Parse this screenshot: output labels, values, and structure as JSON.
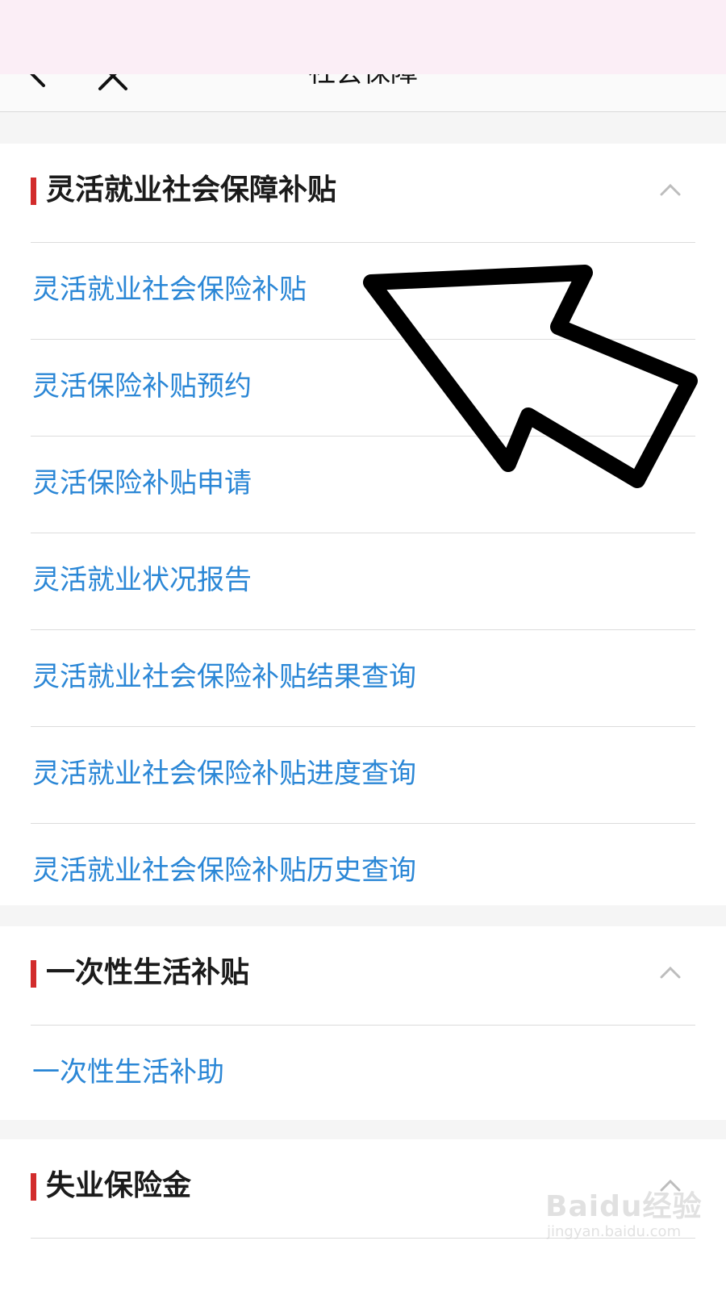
{
  "header": {
    "title": "社会保障",
    "back_icon": "chevron-left-icon",
    "close_icon": "close-icon"
  },
  "sections": [
    {
      "title": "灵活就业社会保障补贴",
      "chevron_icon": "chevron-up-icon",
      "items": [
        "灵活就业社会保险补贴",
        "灵活保险补贴预约",
        "灵活保险补贴申请",
        "灵活就业状况报告",
        "灵活就业社会保险补贴结果查询",
        "灵活就业社会保险补贴进度查询",
        "灵活就业社会保险补贴历史查询"
      ]
    },
    {
      "title": "一次性生活补贴",
      "chevron_icon": "chevron-up-icon",
      "items": [
        "一次性生活补助"
      ]
    },
    {
      "title": "失业保险金",
      "chevron_icon": "chevron-up-icon",
      "items": []
    }
  ],
  "watermark": {
    "logo": "Baidu经验",
    "url": "jingyan.baidu.com"
  },
  "colors": {
    "link": "#2b87d6",
    "accent_bar": "#d22c2c",
    "top_band": "#fbeef6"
  }
}
